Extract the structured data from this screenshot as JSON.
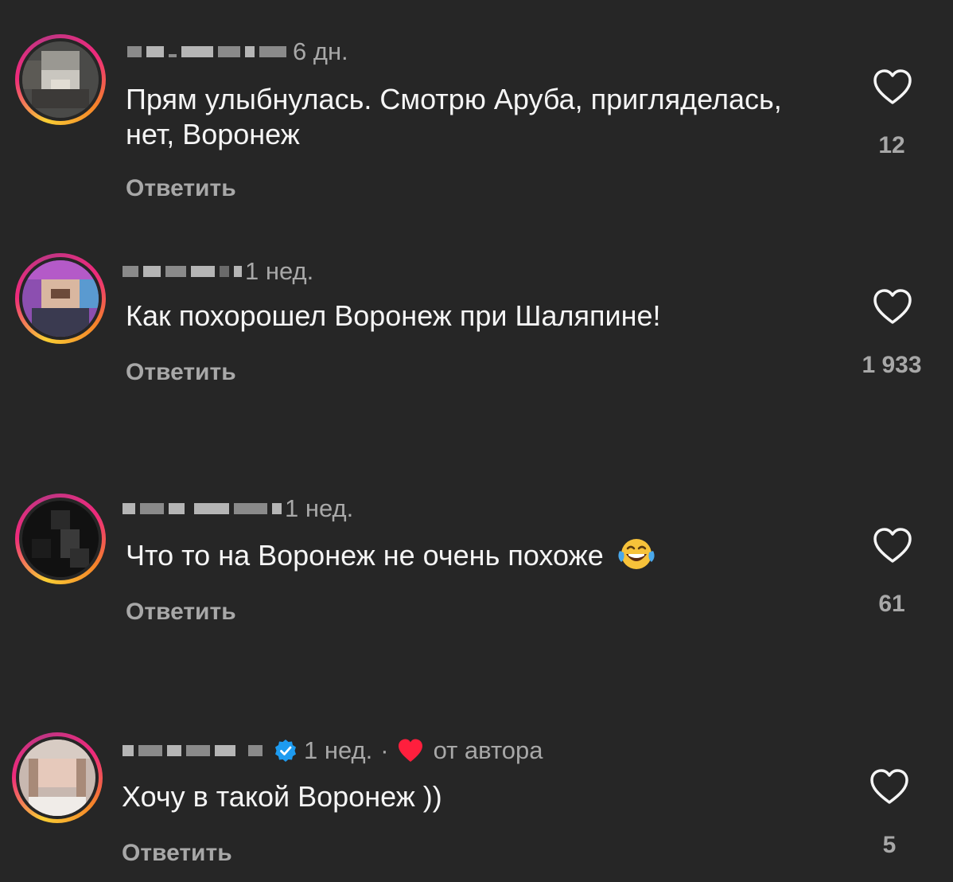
{
  "colors": {
    "background": "#262626",
    "text_primary": "#f5f5f5",
    "text_secondary": "#a8a8a8",
    "verified_blue": "#1d9bf0",
    "author_heart": "#ff1f3d"
  },
  "comments": [
    {
      "time": "6 дн.",
      "text": "Прям улыбнулась. Смотрю Аруба, пригляделась, нет, Воронеж",
      "reply_label": "Ответить",
      "likes": "12",
      "like_icon": "heart-outline-icon"
    },
    {
      "time": "1 нед.",
      "text": "Как похорошел Воронеж при Шаляпине!",
      "reply_label": "Ответить",
      "likes": "1 933",
      "like_icon": "heart-outline-icon"
    },
    {
      "time": "1 нед.",
      "text": "Что то на Воронеж не очень похоже",
      "emoji": "face-with-tears-of-joy-emoji",
      "reply_label": "Ответить",
      "likes": "61",
      "like_icon": "heart-outline-icon"
    },
    {
      "time": "1 нед.",
      "verified": true,
      "separator": "·",
      "author_label": "от автора",
      "author_icon": "heart-filled-icon",
      "text": "Хочу в такой Воронеж ))",
      "reply_label": "Ответить",
      "likes": "5",
      "like_icon": "heart-outline-icon"
    }
  ]
}
